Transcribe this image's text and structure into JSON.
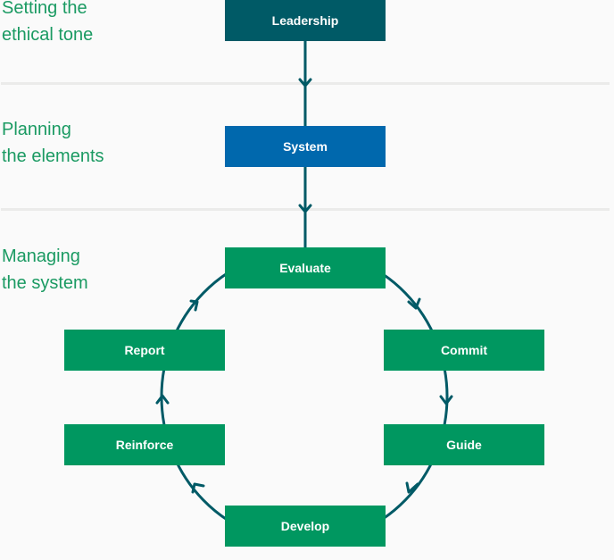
{
  "colors": {
    "label_text": "#1a9a62",
    "leadership_fill": "#005a66",
    "system_fill": "#0068ad",
    "cycle_fill": "#009760",
    "connector": "#005a66",
    "divider": "#ebebea",
    "background": "#fafafa"
  },
  "stages": [
    {
      "line1": "Setting the",
      "line2": "ethical tone"
    },
    {
      "line1": "Planning",
      "line2": "the elements"
    },
    {
      "line1": "Managing",
      "line2": "the system"
    }
  ],
  "boxes": {
    "leadership": "Leadership",
    "system": "System",
    "evaluate": "Evaluate",
    "commit": "Commit",
    "guide": "Guide",
    "develop": "Develop",
    "reinforce": "Reinforce",
    "report": "Report"
  },
  "flow": {
    "linear": [
      "Leadership",
      "System",
      "Evaluate"
    ],
    "cycle": [
      "Evaluate",
      "Commit",
      "Guide",
      "Develop",
      "Reinforce",
      "Report",
      "Evaluate"
    ],
    "cycle_direction": "clockwise"
  }
}
